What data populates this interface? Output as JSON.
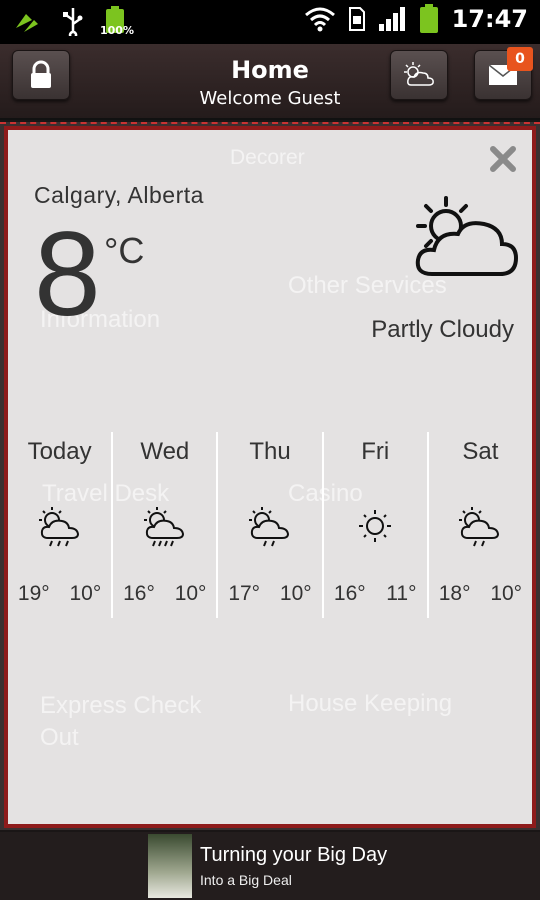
{
  "status_bar": {
    "time": "17:47",
    "battery_percent": "100%"
  },
  "header": {
    "title": "Home",
    "subtitle": "Welcome Guest",
    "notification_count": "0"
  },
  "background_menu": {
    "items": [
      "Decorer",
      "Other Services",
      "Information",
      "Travel Desk",
      "Casino",
      "Express Check Out",
      "House Keeping"
    ]
  },
  "weather": {
    "location": "Calgary, Alberta",
    "temperature": "8",
    "unit": "°C",
    "condition": "Partly Cloudy",
    "forecast": [
      {
        "day": "Today",
        "icon": "sun-cloud-rain-icon",
        "high": "19°",
        "low": "10°"
      },
      {
        "day": "Wed",
        "icon": "sun-cloud-rain-icon",
        "high": "16°",
        "low": "10°"
      },
      {
        "day": "Thu",
        "icon": "sun-cloud-rain-icon",
        "high": "17°",
        "low": "10°"
      },
      {
        "day": "Fri",
        "icon": "sun-icon",
        "high": "16°",
        "low": "11°"
      },
      {
        "day": "Sat",
        "icon": "sun-cloud-rain-icon",
        "high": "18°",
        "low": "10°"
      }
    ]
  },
  "ad": {
    "title": "Turning your Big Day",
    "subtitle": "Into a Big Deal"
  },
  "colors": {
    "overlay_border": "#8e1b1b",
    "badge": "#e8541e",
    "battery": "#7cc41f"
  }
}
